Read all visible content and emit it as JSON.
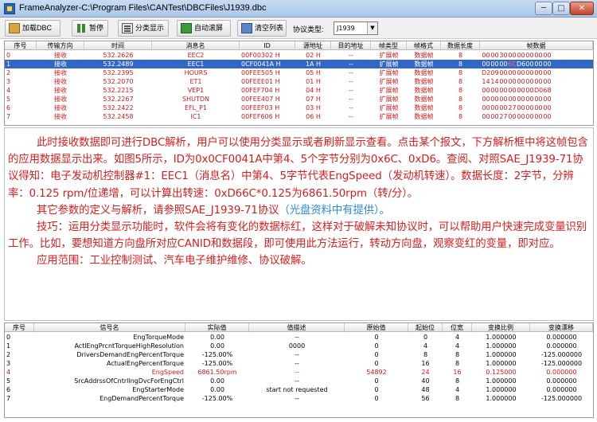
{
  "window": {
    "title": "FrameAnalyzer-C:\\Program Files\\CANTest\\DBCFiles\\J1939.dbc",
    "min_label": "─",
    "max_label": "□",
    "close_label": "✕"
  },
  "toolbar": {
    "load_dbc": "加载DBC",
    "pause": "暂停",
    "class_view": "分类显示",
    "auto_scroll": "自动滚屏",
    "clear_list": "清空列表",
    "protocol_label": "协议类型:",
    "protocol_value": "J1939",
    "protocol_arrow": "▼"
  },
  "frames": {
    "headers": [
      "序号",
      "传输方向",
      "时间",
      "消息名",
      "ID",
      "源地址",
      "目的地址",
      "帧类型",
      "帧格式",
      "数据长度",
      "帧数据"
    ],
    "rows": [
      {
        "idx": "0",
        "dir": "接收",
        "time": "532.2626",
        "msg": "EEC2",
        "id": "00F00302 H",
        "src": "02 H",
        "dst": "--",
        "ftype": "扩展帧",
        "fmt": "数据帧",
        "len": "8",
        "data": [
          "00",
          "00",
          "30",
          "00",
          "00",
          "00",
          "00",
          "00"
        ],
        "red": [
          2
        ],
        "selected": false
      },
      {
        "idx": "1",
        "dir": "接收",
        "time": "532.2489",
        "msg": "EEC1",
        "id": "0CF0041A H",
        "src": "1A H",
        "dst": "--",
        "ftype": "扩展帧",
        "fmt": "数据帧",
        "len": "8",
        "data": [
          "00",
          "00",
          "00",
          "6C",
          "D6",
          "00",
          "00",
          "00"
        ],
        "red": [
          3
        ],
        "selected": true
      },
      {
        "idx": "2",
        "dir": "接收",
        "time": "532.2395",
        "msg": "HOURS",
        "id": "00FEE505 H",
        "src": "05 H",
        "dst": "--",
        "ftype": "扩展帧",
        "fmt": "数据帧",
        "len": "8",
        "data": [
          "D2",
          "09",
          "00",
          "00",
          "00",
          "00",
          "00",
          "00"
        ],
        "red": [
          0,
          1
        ],
        "selected": false
      },
      {
        "idx": "3",
        "dir": "接收",
        "time": "532.2070",
        "msg": "ET1",
        "id": "00FEEE01 H",
        "src": "01 H",
        "dst": "--",
        "ftype": "扩展帧",
        "fmt": "数据帧",
        "len": "8",
        "data": [
          "14",
          "14",
          "00",
          "00",
          "00",
          "00",
          "00",
          "00"
        ],
        "red": [
          0,
          1
        ],
        "selected": false
      },
      {
        "idx": "4",
        "dir": "接收",
        "time": "532.2215",
        "msg": "VEP1",
        "id": "00FEF704 H",
        "src": "04 H",
        "dst": "--",
        "ftype": "扩展帧",
        "fmt": "数据帧",
        "len": "8",
        "data": [
          "00",
          "00",
          "00",
          "00",
          "00",
          "00",
          "D0",
          "68"
        ],
        "red": [
          6
        ],
        "selected": false
      },
      {
        "idx": "5",
        "dir": "接收",
        "time": "532.2267",
        "msg": "SHUTDN",
        "id": "00FEE407 H",
        "src": "07 H",
        "dst": "--",
        "ftype": "扩展帧",
        "fmt": "数据帧",
        "len": "8",
        "data": [
          "00",
          "00",
          "00",
          "00",
          "00",
          "00",
          "00",
          "00"
        ],
        "red": [],
        "selected": false
      },
      {
        "idx": "6",
        "dir": "接收",
        "time": "532.2422",
        "msg": "EFL_P1",
        "id": "00FEEF03 H",
        "src": "03 H",
        "dst": "--",
        "ftype": "扩展帧",
        "fmt": "数据帧",
        "len": "8",
        "data": [
          "00",
          "00",
          "00",
          "27",
          "00",
          "00",
          "00",
          "00"
        ],
        "red": [
          3
        ],
        "selected": false
      },
      {
        "idx": "7",
        "dir": "接收",
        "time": "532.2458",
        "msg": "IC1",
        "id": "00FEF606 H",
        "src": "06 H",
        "dst": "--",
        "ftype": "扩展帧",
        "fmt": "数据帧",
        "len": "8",
        "data": [
          "00",
          "00",
          "27",
          "00",
          "00",
          "00",
          "00",
          "00"
        ],
        "red": [
          2
        ],
        "selected": false
      }
    ]
  },
  "description": {
    "p1": "此时接收数据即可进行DBC解析，用户可以使用分类显示或者刷新显示查看。点击某个报文，下方解析框中将这帧包含的应用数据显示出来。如图5所示，ID为0x0CF0041A中第4、5个字节分别为0x6C、0xD6。查阅、对照SAE_J1939-71协议得知：电子发动机控制器#1：EEC1（消息名）中第4、5字节代表EngSpeed（发动机转速）。数据长度：2字节，分辨率：0.125 rpm/位递增，可以计算出转速：0xD66C*0.125为6861.50rpm（转/分）。",
    "p2_main": "其它参数的定义与解析，请参照SAE_J1939-71协议",
    "p2_note": "（光盘资料中有提供）。",
    "p3": "技巧：运用分类显示功能时，软件会将有变化的数据标红，这样对于破解未知协议时，可以帮助用户快速完成变量识别工作。比如，要想知道方向盘所对应CANID和数据段，即可使用此方法运行，转动方向盘，观察变红的变量，即对应。",
    "p4": "应用范围：工业控制测试、汽车电子维护维修、协议破解。"
  },
  "signals": {
    "headers": [
      "序号",
      "信号名",
      "实际值",
      "值描述",
      "原始值",
      "起始位",
      "位宽",
      "变换比例",
      "变换漂移"
    ],
    "rows": [
      {
        "idx": "0",
        "name": "EngTorqueMode",
        "value": "0.00",
        "desc": "--",
        "raw": "0",
        "start": "0",
        "width": "4",
        "scale": "1.000000",
        "offset": "0.000000",
        "red": false
      },
      {
        "idx": "1",
        "name": "ActlEngPrcntTorqueHighResolution",
        "value": "0.00",
        "desc": "0000",
        "raw": "0",
        "start": "4",
        "width": "4",
        "scale": "1.000000",
        "offset": "0.000000",
        "red": false
      },
      {
        "idx": "2",
        "name": "DriversDemandEngPercentTorque",
        "value": "-125.00%",
        "desc": "--",
        "raw": "0",
        "start": "8",
        "width": "8",
        "scale": "1.000000",
        "offset": "-125.000000",
        "red": false
      },
      {
        "idx": "3",
        "name": "ActualEngPercentTorque",
        "value": "-125.00%",
        "desc": "--",
        "raw": "0",
        "start": "16",
        "width": "8",
        "scale": "1.000000",
        "offset": "-125.000000",
        "red": false
      },
      {
        "idx": "4",
        "name": "EngSpeed",
        "value": "6861.50rpm",
        "desc": "--",
        "raw": "54892",
        "start": "24",
        "width": "16",
        "scale": "0.125000",
        "offset": "0.000000",
        "red": true
      },
      {
        "idx": "5",
        "name": "SrcAddrssOfCntrllngDvcForEngCtrl",
        "value": "0.00",
        "desc": "--",
        "raw": "0",
        "start": "40",
        "width": "8",
        "scale": "1.000000",
        "offset": "0.000000",
        "red": false
      },
      {
        "idx": "6",
        "name": "EngStarterMode",
        "value": "0.00",
        "desc": "start not requested",
        "raw": "0",
        "start": "48",
        "width": "4",
        "scale": "1.000000",
        "offset": "0.000000",
        "red": false
      },
      {
        "idx": "7",
        "name": "EngDemandPercentTorque",
        "value": "-125.00%",
        "desc": "--",
        "raw": "0",
        "start": "56",
        "width": "8",
        "scale": "1.000000",
        "offset": "-125.000000",
        "red": false
      }
    ]
  }
}
